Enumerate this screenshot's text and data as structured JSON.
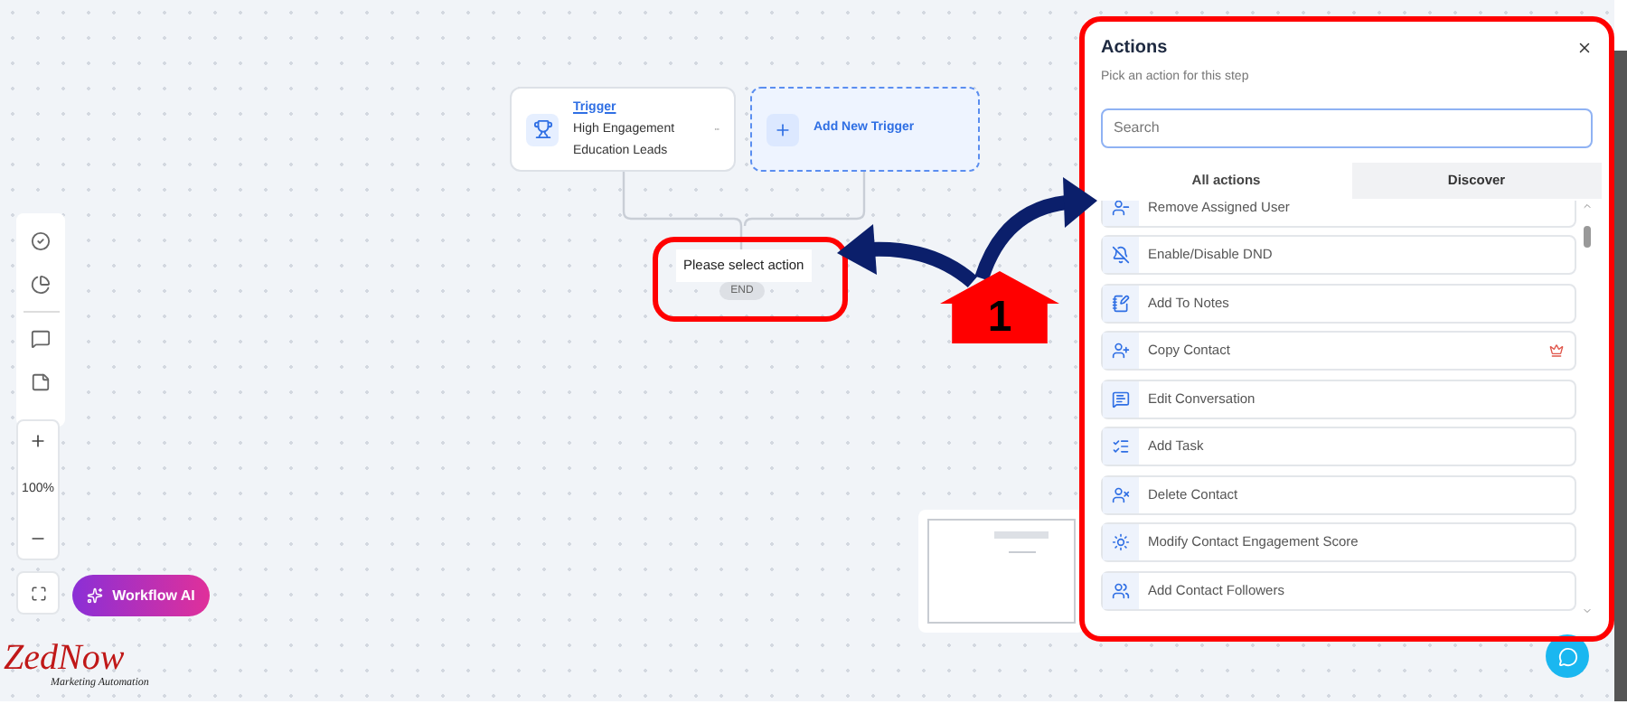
{
  "canvas": {
    "trigger": {
      "label": "Trigger",
      "name": "High Engagement Education Leads"
    },
    "add_trigger": {
      "label": "Add New Trigger"
    },
    "action_placeholder": {
      "label": "Please select action"
    },
    "end_badge": "END",
    "zoom": {
      "value": "100%"
    },
    "ai_button": {
      "label": "Workflow AI"
    }
  },
  "logo": {
    "name": "ZedNow",
    "tagline": "Marketing Automation"
  },
  "actions_panel": {
    "title": "Actions",
    "subtitle": "Pick an action for this step",
    "search": {
      "placeholder": "Search"
    },
    "tabs": [
      {
        "label": "All actions",
        "selected": true
      },
      {
        "label": "Discover",
        "selected": false
      }
    ],
    "items": [
      {
        "label": "Remove Assigned User",
        "premium": false
      },
      {
        "label": "Enable/Disable DND",
        "premium": false
      },
      {
        "label": "Add To Notes",
        "premium": false
      },
      {
        "label": "Copy Contact",
        "premium": true
      },
      {
        "label": "Edit Conversation",
        "premium": false
      },
      {
        "label": "Add Task",
        "premium": false
      },
      {
        "label": "Delete Contact",
        "premium": false
      },
      {
        "label": "Modify Contact Engagement Score",
        "premium": false
      },
      {
        "label": "Add Contact Followers",
        "premium": false
      }
    ]
  },
  "annotations": {
    "step_badge": "1"
  }
}
